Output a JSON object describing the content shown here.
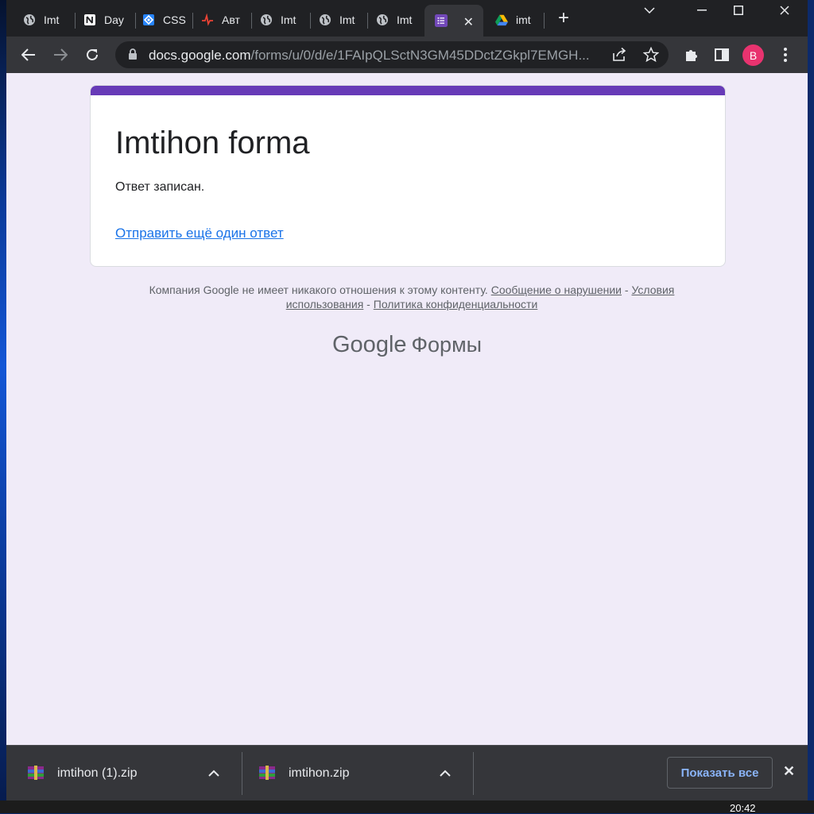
{
  "tabs": [
    {
      "label": "Imt",
      "icon": "globe-icon"
    },
    {
      "label": "Day",
      "icon": "notion-icon"
    },
    {
      "label": "CSS",
      "icon": "jira-icon"
    },
    {
      "label": "Авт",
      "icon": "heartbeat-icon"
    },
    {
      "label": "Imt",
      "icon": "globe-icon"
    },
    {
      "label": "Imt",
      "icon": "globe-icon"
    },
    {
      "label": "Imt",
      "icon": "globe-icon"
    },
    {
      "label": "",
      "icon": "google-forms-icon",
      "active": true
    },
    {
      "label": "imt",
      "icon": "google-drive-icon"
    }
  ],
  "address_bar": {
    "host": "docs.google.com",
    "path": "/forms/u/0/d/e/1FAIpQLSctN3GM45DDctZGkpl7EMGH..."
  },
  "profile": {
    "initial": "B"
  },
  "form": {
    "title": "Imtihon forma",
    "confirmation": "Ответ записан.",
    "submit_again": "Отправить ещё один ответ"
  },
  "footer": {
    "disclaimer": "Компания Google не имеет никакого отношения к этому контенту.",
    "report": "Сообщение о нарушении",
    "separator1": " - ",
    "terms": "Условия использования",
    "separator2": " - ",
    "privacy": "Политика конфиденциальности",
    "brand_google": "Google",
    "brand_forms": "Формы"
  },
  "downloads": {
    "items": [
      {
        "name": "imtihon (1).zip"
      },
      {
        "name": "imtihon.zip"
      }
    ],
    "show_all": "Показать все"
  },
  "taskbar": {
    "clock": "20:42"
  },
  "colors": {
    "accent": "#673ab7",
    "link": "#1a73e8",
    "page_bg": "#f0ebf8"
  }
}
